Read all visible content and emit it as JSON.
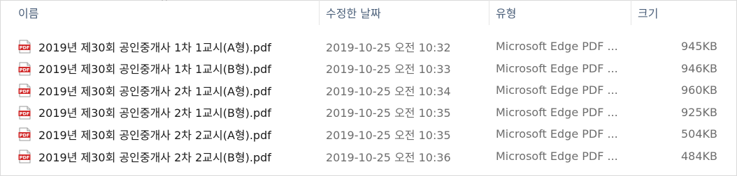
{
  "columns": {
    "name": "이름",
    "date": "수정한 날짜",
    "type": "유형",
    "size": "크기"
  },
  "sort_indicator": "^",
  "files": [
    {
      "name": "2019년 제30회 공인중개사 1차 1교시(A형).pdf",
      "date": "2019-10-25 오전 10:32",
      "type": "Microsoft Edge PDF ...",
      "size": "945KB",
      "icon": "pdf-icon"
    },
    {
      "name": "2019년 제30회 공인중개사 1차 1교시(B형).pdf",
      "date": "2019-10-25 오전 10:33",
      "type": "Microsoft Edge PDF ...",
      "size": "946KB",
      "icon": "pdf-icon"
    },
    {
      "name": "2019년 제30회 공인중개사 2차 1교시(A형).pdf",
      "date": "2019-10-25 오전 10:34",
      "type": "Microsoft Edge PDF ...",
      "size": "960KB",
      "icon": "pdf-icon"
    },
    {
      "name": "2019년 제30회 공인중개사 2차 1교시(B형).pdf",
      "date": "2019-10-25 오전 10:35",
      "type": "Microsoft Edge PDF ...",
      "size": "925KB",
      "icon": "pdf-icon"
    },
    {
      "name": "2019년 제30회 공인중개사 2차 2교시(A형).pdf",
      "date": "2019-10-25 오전 10:35",
      "type": "Microsoft Edge PDF ...",
      "size": "504KB",
      "icon": "pdf-icon"
    },
    {
      "name": "2019년 제30회 공인중개사 2차 2교시(B형).pdf",
      "date": "2019-10-25 오전 10:36",
      "type": "Microsoft Edge PDF ...",
      "size": "484KB",
      "icon": "pdf-icon"
    }
  ],
  "colors": {
    "header_text": "#4c607a",
    "pdf_red": "#d12a2a"
  }
}
